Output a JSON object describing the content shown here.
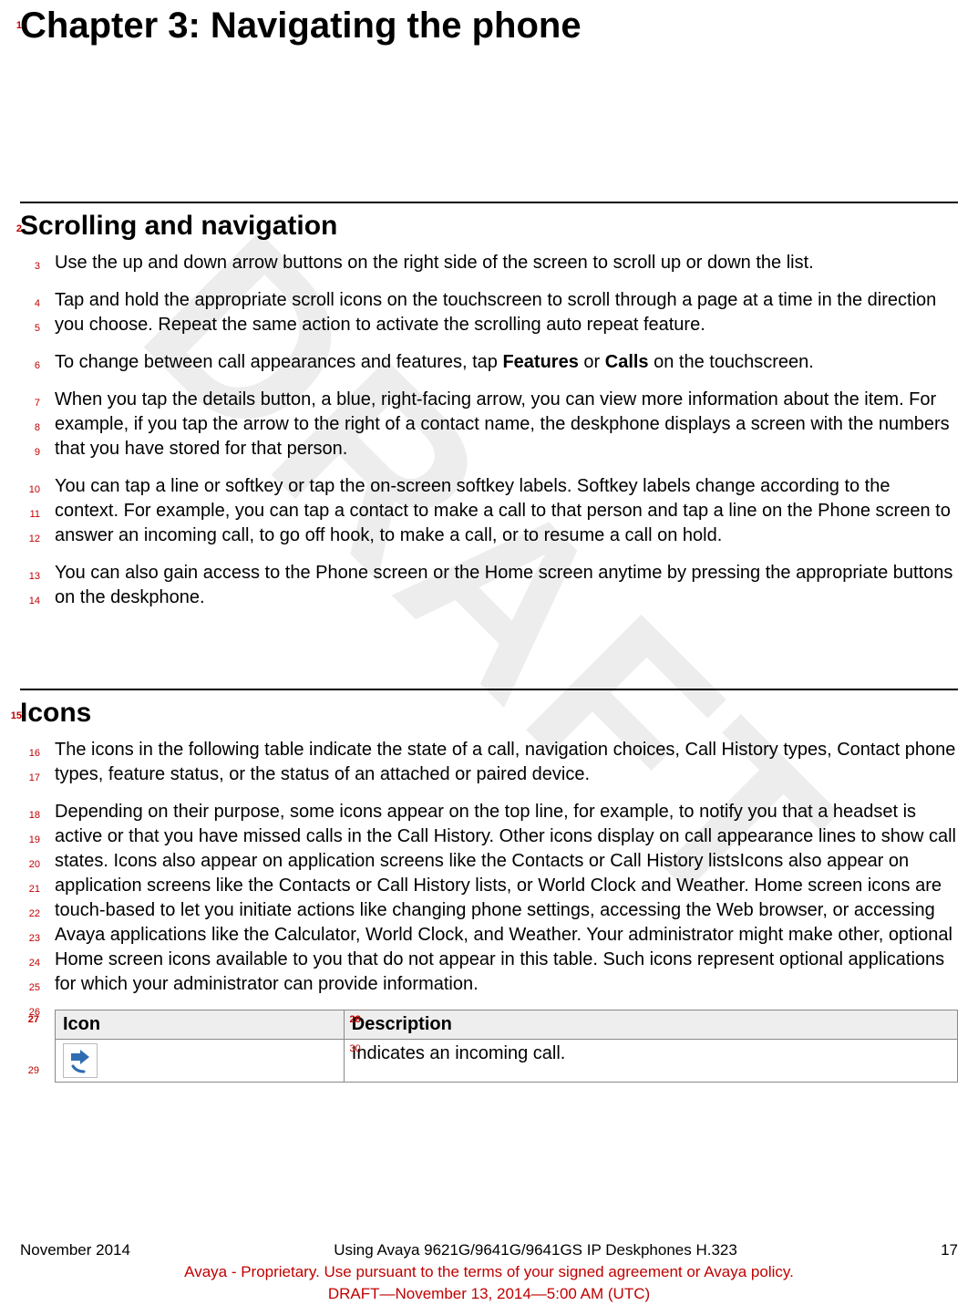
{
  "watermark": "DRAFT",
  "chapter": {
    "lineno": "1",
    "title": "Chapter 3:  Navigating the phone"
  },
  "section1": {
    "lineno": "2",
    "title": "Scrolling and navigation",
    "paras": [
      {
        "lines": [
          "3"
        ],
        "text": "Use the up and down arrow buttons on the right side of the screen to scroll up or down the list."
      },
      {
        "lines": [
          "4",
          "5"
        ],
        "text": "Tap and hold the appropriate scroll icons on the touchscreen to scroll through a page at a time in the direction you choose. Repeat the same action to activate the scrolling auto repeat feature."
      },
      {
        "lines": [
          "6"
        ],
        "pre": "To change between call appearances and features, tap ",
        "b1": "Features",
        "mid": " or ",
        "b2": "Calls",
        "post": " on the touchscreen."
      },
      {
        "lines": [
          "7",
          "8",
          "9"
        ],
        "text": "When you tap the details button, a blue, right-facing arrow, you can view more information about the item. For example, if you tap the arrow to the right of a contact name, the deskphone displays a screen with the numbers that you have stored for that person."
      },
      {
        "lines": [
          "10",
          "11",
          "12"
        ],
        "text": "You can tap a line or softkey or tap the on-screen softkey labels. Softkey labels change according to the context. For example, you can tap a contact to make a call to that person and tap a line on the Phone screen to answer an incoming call, to go off hook, to make a call, or to resume a call on hold."
      },
      {
        "lines": [
          "13",
          "14"
        ],
        "text": "You can also gain access to the Phone screen or the Home screen anytime by pressing the appropriate buttons on the deskphone."
      }
    ]
  },
  "section2": {
    "lineno": "15",
    "title": "Icons",
    "paras": [
      {
        "lines": [
          "16",
          "17"
        ],
        "text": "The icons in the following table indicate the state of a call, navigation choices, Call History types, Contact phone types, feature status, or the status of an attached or paired device."
      },
      {
        "lines": [
          "18",
          "19",
          "20",
          "21",
          "22",
          "23",
          "24",
          "25",
          "26"
        ],
        "text": "Depending on their purpose, some icons appear on the top line, for example, to notify you that a headset is active or that you have missed calls in the Call History. Other icons display on call appearance lines to show call states. Icons also appear on application screens like the Contacts or Call History listsIcons also appear on application screens like the Contacts or Call History lists, or World Clock and Weather. Home screen icons are touch-based to let you initiate actions like changing phone settings, accessing the Web browser, or accessing Avaya applications like the Calculator, World Clock, and Weather. Your administrator might make other, optional Home screen icons available to you that do not appear in this table. Such icons represent optional applications for which your administrator can provide information."
      }
    ],
    "table": {
      "header": {
        "c1": {
          "lineno": "27",
          "label": "Icon"
        },
        "c2": {
          "lineno": "28",
          "label": "Description"
        }
      },
      "row1": {
        "c1_lineno": "29",
        "c2_lineno": "30",
        "desc": "Indicates an incoming call."
      }
    }
  },
  "footer": {
    "left": "November 2014",
    "center_title": "Using Avaya 9621G/9641G/9641GS IP Deskphones H.323",
    "page": "17",
    "line1": "Avaya - Proprietary. Use pursuant to the terms of your signed agreement or Avaya policy.",
    "line2": "DRAFT—November 13, 2014—5:00 AM (UTC)"
  }
}
